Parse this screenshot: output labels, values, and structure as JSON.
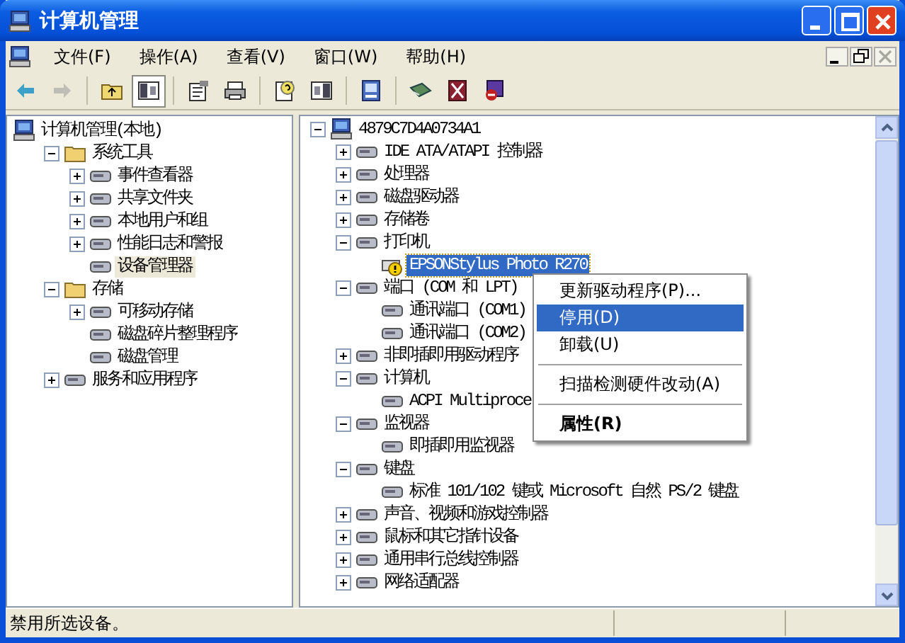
{
  "window": {
    "title": "计算机管理"
  },
  "menu": [
    {
      "label": "文件(F)"
    },
    {
      "label": "操作(A)"
    },
    {
      "label": "查看(V)"
    },
    {
      "label": "窗口(W)"
    },
    {
      "label": "帮助(H)"
    }
  ],
  "toolbar": [
    [
      {
        "pressed": false,
        "disabled": false
      },
      {
        "pressed": false,
        "disabled": true
      }
    ],
    [
      {
        "pressed": false,
        "disabled": false
      },
      {
        "pressed": true,
        "disabled": false
      }
    ],
    [
      {
        "pressed": false,
        "disabled": false
      },
      {
        "pressed": false,
        "disabled": false
      }
    ],
    [
      {
        "pressed": false,
        "disabled": false
      },
      {
        "pressed": false,
        "disabled": false
      }
    ],
    [
      {
        "pressed": false,
        "disabled": false
      }
    ],
    [
      {
        "pressed": false,
        "disabled": false
      },
      {
        "pressed": false,
        "disabled": false
      },
      {
        "pressed": false,
        "disabled": false
      }
    ]
  ],
  "left_tree": [
    {
      "label": "计算机管理(本地)",
      "selected": false,
      "children": [
        {
          "label": "系统工具",
          "selected": false,
          "expanded": true,
          "children": [
            {
              "label": "事件查看器",
              "selected": false,
              "expanded": false
            },
            {
              "label": "共享文件夹",
              "selected": false,
              "expanded": false
            },
            {
              "label": "本地用户和组",
              "selected": false,
              "expanded": false
            },
            {
              "label": "性能日志和警报",
              "selected": false,
              "expanded": false
            },
            {
              "label": "设备管理器",
              "selected": true
            }
          ]
        },
        {
          "label": "存储",
          "selected": false,
          "expanded": true,
          "children": [
            {
              "label": "可移动存储",
              "selected": false,
              "expanded": false
            },
            {
              "label": "磁盘碎片整理程序",
              "selected": false
            },
            {
              "label": "磁盘管理",
              "selected": false
            }
          ]
        },
        {
          "label": "服务和应用程序",
          "selected": false,
          "expanded": false
        }
      ]
    }
  ],
  "right_tree": [
    {
      "label": "4879C7D4A0734A1",
      "selected": false,
      "expanded": true,
      "children": [
        {
          "label": "IDE ATA/ATAPI 控制器",
          "selected": false,
          "expanded": false
        },
        {
          "label": "处理器",
          "selected": false,
          "expanded": false
        },
        {
          "label": "磁盘驱动器",
          "selected": false,
          "expanded": false
        },
        {
          "label": "存储卷",
          "selected": false,
          "expanded": false
        },
        {
          "label": "打印机",
          "selected": false,
          "expanded": true,
          "children": [
            {
              "label": "EPSONStylus Photo R270",
              "selected": true,
              "warning": true
            }
          ]
        },
        {
          "label": "端口 (COM 和 LPT)",
          "selected": false,
          "expanded": true,
          "children": [
            {
              "label": "通讯端口 (COM1)",
              "selected": false
            },
            {
              "label": "通讯端口 (COM2)",
              "selected": false
            }
          ]
        },
        {
          "label": "非即插即用驱动程序",
          "selected": false,
          "expanded": false
        },
        {
          "label": "计算机",
          "selected": false,
          "expanded": true,
          "children": [
            {
              "label": "ACPI Multiproce",
              "selected": false
            }
          ]
        },
        {
          "label": "监视器",
          "selected": false,
          "expanded": true,
          "children": [
            {
              "label": "即插即用监视器",
              "selected": false
            }
          ]
        },
        {
          "label": "键盘",
          "selected": false,
          "expanded": true,
          "children": [
            {
              "label": "标准 101/102 键或 Microsoft 自然 PS/2 键盘",
              "selected": false
            }
          ]
        },
        {
          "label": "声音、视频和游戏控制器",
          "selected": false,
          "expanded": false
        },
        {
          "label": "鼠标和其它指针设备",
          "selected": false,
          "expanded": false
        },
        {
          "label": "通用串行总线控制器",
          "selected": false,
          "expanded": false
        },
        {
          "label": "网络适配器",
          "selected": false,
          "expanded": false
        }
      ]
    }
  ],
  "context_menu": [
    {
      "kind": "item",
      "label": "更新驱动程序(P)...",
      "selected": false,
      "bold": false
    },
    {
      "kind": "item",
      "label": "停用(D)",
      "selected": true,
      "bold": false
    },
    {
      "kind": "item",
      "label": "卸载(U)",
      "selected": false,
      "bold": false
    },
    {
      "kind": "separator"
    },
    {
      "kind": "item",
      "label": "扫描检测硬件改动(A)",
      "selected": false,
      "bold": false
    },
    {
      "kind": "separator"
    },
    {
      "kind": "item",
      "label": "属性(R)",
      "selected": false,
      "bold": true
    }
  ],
  "status_bar": {
    "text": "禁用所选设备。"
  }
}
